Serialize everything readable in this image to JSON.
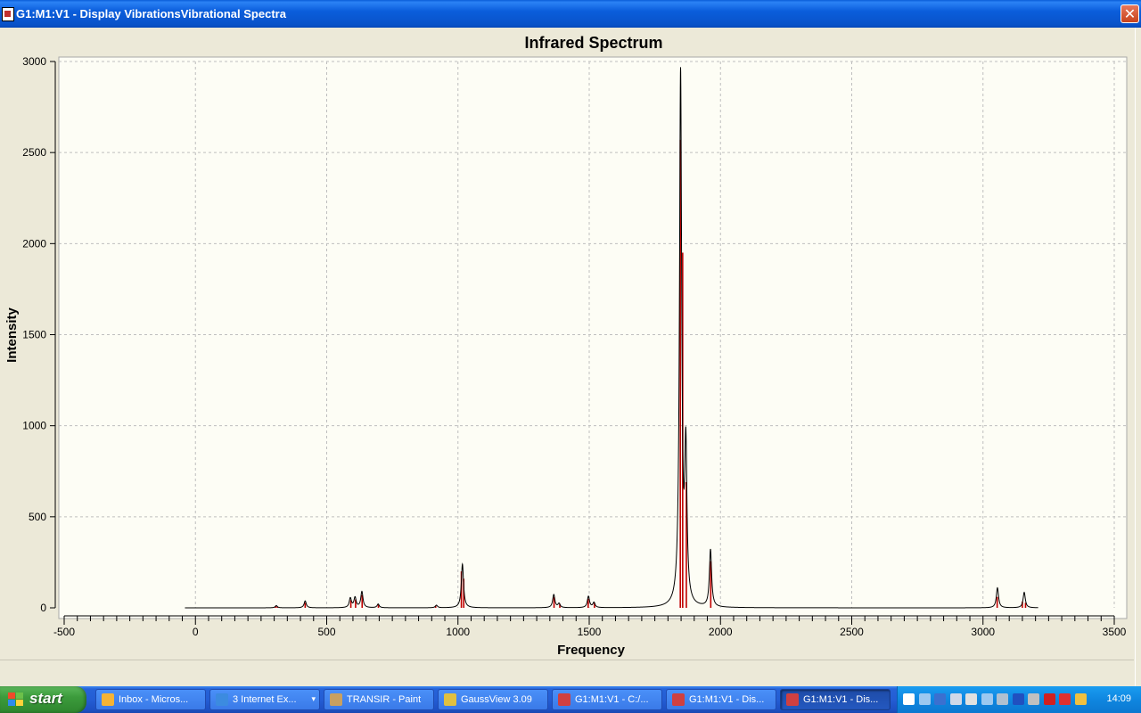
{
  "window": {
    "title": "G1:M1:V1 - Display VibrationsVibrational Spectra",
    "close_glyph": "✕"
  },
  "chart_data": {
    "type": "line",
    "title": "Infrared Spectrum",
    "xlabel": "Frequency",
    "ylabel": "Intensity",
    "xlim": [
      -500,
      3500
    ],
    "ylim": [
      0,
      3000
    ],
    "x_ticks": [
      -500,
      0,
      500,
      1000,
      1500,
      2000,
      2500,
      3000,
      3500
    ],
    "y_ticks": [
      0,
      500,
      1000,
      1500,
      2000,
      2500,
      3000
    ],
    "grid": true,
    "series": [
      {
        "style": "black-line",
        "color": "#000000",
        "x_range": [
          -40,
          3210
        ],
        "peaks": [
          {
            "x": 308,
            "y": 12
          },
          {
            "x": 418,
            "y": 38
          },
          {
            "x": 590,
            "y": 52
          },
          {
            "x": 608,
            "y": 55
          },
          {
            "x": 634,
            "y": 88
          },
          {
            "x": 696,
            "y": 20
          },
          {
            "x": 918,
            "y": 14
          },
          {
            "x": 1017,
            "y": 240
          },
          {
            "x": 1365,
            "y": 72
          },
          {
            "x": 1385,
            "y": 22
          },
          {
            "x": 1497,
            "y": 62
          },
          {
            "x": 1518,
            "y": 28
          },
          {
            "x": 1848,
            "y": 2920
          },
          {
            "x": 1868,
            "y": 820
          },
          {
            "x": 1962,
            "y": 315
          },
          {
            "x": 3055,
            "y": 110
          },
          {
            "x": 3157,
            "y": 85
          }
        ]
      },
      {
        "style": "red-sticks",
        "color": "#C00000",
        "sticks": [
          {
            "x": 305,
            "y": 10
          },
          {
            "x": 312,
            "y": 8
          },
          {
            "x": 418,
            "y": 28
          },
          {
            "x": 592,
            "y": 42
          },
          {
            "x": 610,
            "y": 46
          },
          {
            "x": 635,
            "y": 70
          },
          {
            "x": 697,
            "y": 18
          },
          {
            "x": 915,
            "y": 12
          },
          {
            "x": 1013,
            "y": 200
          },
          {
            "x": 1022,
            "y": 160
          },
          {
            "x": 1366,
            "y": 60
          },
          {
            "x": 1388,
            "y": 22
          },
          {
            "x": 1496,
            "y": 50
          },
          {
            "x": 1520,
            "y": 28
          },
          {
            "x": 1847,
            "y": 2570
          },
          {
            "x": 1856,
            "y": 1950
          },
          {
            "x": 1870,
            "y": 690
          },
          {
            "x": 1963,
            "y": 255
          },
          {
            "x": 3054,
            "y": 60
          },
          {
            "x": 3150,
            "y": 35
          },
          {
            "x": 3162,
            "y": 28
          }
        ]
      }
    ]
  },
  "taskbar": {
    "start_label": "start",
    "tasks": [
      {
        "label": "Inbox - Micros...",
        "icon": "email-client-icon",
        "color": "#F5B335",
        "active": false
      },
      {
        "label": "3 Internet Ex...",
        "icon": "internet-explorer-icon",
        "color": "#3C8BE0",
        "active": false,
        "has_dropdown": true,
        "dropdown_glyph": "▾"
      },
      {
        "label": "TRANSIR - Paint",
        "icon": "paint-icon",
        "color": "#C8A060",
        "active": false
      },
      {
        "label": "GaussView 3.09",
        "icon": "gaussview-icon",
        "color": "#E0C040",
        "active": false
      },
      {
        "label": "G1:M1:V1 - C:/...",
        "icon": "gaussview-window-icon",
        "color": "#D04040",
        "active": false
      },
      {
        "label": "G1:M1:V1 - Dis...",
        "icon": "gaussview-window-icon",
        "color": "#D04040",
        "active": false
      },
      {
        "label": "G1:M1:V1 - Dis...",
        "icon": "gaussview-window-icon",
        "color": "#D04040",
        "active": true
      }
    ],
    "tray_icons": [
      "help-icon",
      "network-icon",
      "back-arrow-icon",
      "network-icon",
      "printer-icon",
      "network-icon",
      "settings-icon",
      "bluetooth-icon",
      "usb-icon",
      "security-icon",
      "shield-icon",
      "safely-remove-icon"
    ],
    "clock": "14:09"
  }
}
